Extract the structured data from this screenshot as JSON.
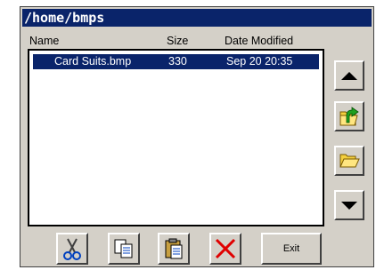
{
  "window": {
    "title": "/home/bmps"
  },
  "columns": {
    "name": "Name",
    "size": "Size",
    "date": "Date Modified"
  },
  "files": [
    {
      "name": "Card Suits.bmp",
      "size": "330",
      "date": "Sep 20 20:35",
      "selected": true
    }
  ],
  "toolbar": {
    "exit_label": "Exit"
  },
  "icons": {
    "side": [
      "up-arrow-icon",
      "folder-up-icon",
      "open-folder-icon",
      "down-arrow-icon"
    ],
    "bottom": [
      "scissors-icon",
      "copy-icon",
      "paste-icon",
      "delete-x-icon"
    ]
  },
  "colors": {
    "selection": "#0a246a",
    "face": "#d4d0c8",
    "delete": "#e00000"
  }
}
